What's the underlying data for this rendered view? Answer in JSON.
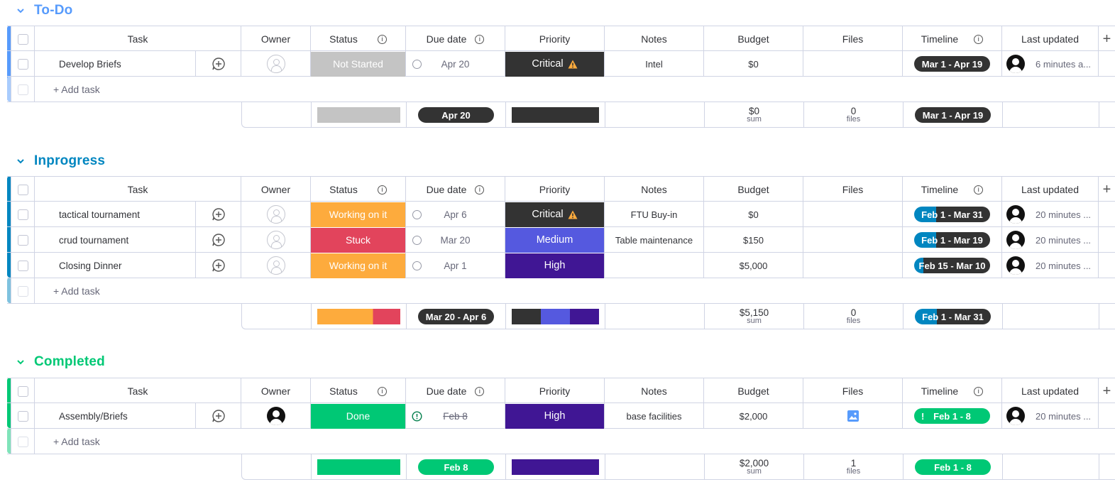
{
  "columns": {
    "task": "Task",
    "owner": "Owner",
    "status": "Status",
    "due": "Due date",
    "priority": "Priority",
    "notes": "Notes",
    "budget": "Budget",
    "files": "Files",
    "timeline": "Timeline",
    "updated": "Last updated"
  },
  "add_task_label": "+ Add task",
  "groups": [
    {
      "title": "To-Do",
      "color": "#579bfc",
      "rows": [
        {
          "task": "Develop Briefs",
          "status": "Not Started",
          "status_color": "#c4c4c4",
          "due": "Apr 20",
          "priority": "Critical",
          "priority_color": "#333333",
          "notes": "Intel",
          "budget": "$0",
          "timeline": "Mar 1 - Apr 19",
          "updated": "6 minutes a..."
        }
      ],
      "summary": {
        "due": "Apr 20",
        "budget": "$0",
        "budget_label": "sum",
        "files": "0",
        "files_label": "files",
        "timeline": "Mar 1 - Apr 19"
      }
    },
    {
      "title": "Inprogress",
      "color": "#0086c0",
      "rows": [
        {
          "task": "tactical tournament",
          "status": "Working on it",
          "status_color": "#fdab3d",
          "due": "Apr 6",
          "priority": "Critical",
          "priority_color": "#333333",
          "notes": "FTU Buy-in",
          "budget": "$0",
          "timeline": "Feb 1 - Mar 31",
          "updated": "20 minutes ..."
        },
        {
          "task": "crud tournament",
          "status": "Stuck",
          "status_color": "#e2445c",
          "due": "Mar 20",
          "priority": "Medium",
          "priority_color": "#5559df",
          "notes": "Table maintenance",
          "budget": "$150",
          "timeline": "Feb 1 - Mar 19",
          "updated": "20 minutes ..."
        },
        {
          "task": "Closing Dinner",
          "status": "Working on it",
          "status_color": "#fdab3d",
          "due": "Apr 1",
          "priority": "High",
          "priority_color": "#401694",
          "notes": "",
          "budget": "$5,000",
          "timeline": "Feb 15 - Mar 10",
          "updated": "20 minutes ..."
        }
      ],
      "summary": {
        "due": "Mar 20 - Apr 6",
        "budget": "$5,150",
        "budget_label": "sum",
        "files": "0",
        "files_label": "files",
        "timeline": "Feb 1 - Mar 31"
      }
    },
    {
      "title": "Completed",
      "color": "#00c875",
      "rows": [
        {
          "task": "Assembly/Briefs",
          "status": "Done",
          "status_color": "#00c875",
          "due": "Feb 8",
          "priority": "High",
          "priority_color": "#401694",
          "notes": "base facilities",
          "budget": "$2,000",
          "timeline": "Feb 1 - 8",
          "updated": "20 minutes ..."
        }
      ],
      "summary": {
        "due": "Feb 8",
        "budget": "$2,000",
        "budget_label": "sum",
        "files": "1",
        "files_label": "files",
        "timeline": "Feb 1 - 8"
      }
    }
  ]
}
